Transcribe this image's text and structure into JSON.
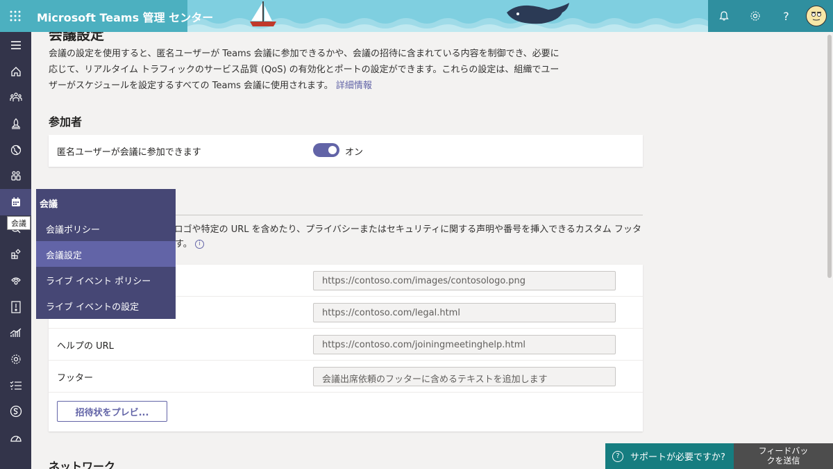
{
  "header": {
    "app_title": "Microsoft Teams 管理 センター",
    "icons": [
      "waffle-icon",
      "bell-icon",
      "gear-icon",
      "help-icon"
    ],
    "help_glyph": "?"
  },
  "rail": {
    "items": [
      "hamburger-icon",
      "home-icon",
      "teams-icon",
      "deploy-icon",
      "globe-icon",
      "users-icon",
      "meetings-icon",
      "messaging-icon",
      "apps-icon",
      "voice-icon",
      "policy-package-icon",
      "analytics-icon",
      "org-settings-icon",
      "planning-icon",
      "skype-icon",
      "dashboard-icon"
    ],
    "tooltip": "会議"
  },
  "flyout": {
    "heading": "会議",
    "items": [
      "会議ポリシー",
      "会議設定",
      "ライブ イベント ポリシー",
      "ライブ イベントの設定"
    ]
  },
  "page": {
    "title": "会議設定",
    "intro_text": "会議の設定を使用すると、匿名ユーザーが Teams 会議に参加できるかや、会議の招待に含まれている内容を制御でき、必要に応じて、リアルタイム トラフィックのサービス品質 (QoS) の有効化とポートの設定ができます。これらの設定は、組織でユーザーがスケジュールを設定するすべての Teams 会議に使用されます。",
    "intro_link": "詳細情報"
  },
  "participants": {
    "title": "参加者",
    "anon_label": "匿名ユーザーが会議に参加できます",
    "anon_state": "オン"
  },
  "email_invitation": {
    "description": "待をカスタマイズして、組織のロゴや特定の URL を含めたり、プライバシーまたはセキュリティに関する声明や番号を挿入できるカスタム フッターを含めたりすることができます。",
    "logo_value": "https://contoso.com/images/contosologo.png",
    "legal_value": "https://contoso.com/legal.html",
    "help_label": "ヘルプの URL",
    "help_value": "https://contoso.com/joiningmeetinghelp.html",
    "footer_label": "フッター",
    "footer_placeholder": "会議出席依頼のフッターに含めるテキストを追加します",
    "preview_button": "招待状をプレビ..."
  },
  "network": {
    "title": "ネットワーク"
  },
  "bottom": {
    "support": "サポートが必要ですか?",
    "feedback_line1": "フィードバッ",
    "feedback_line2": "クを送信"
  }
}
